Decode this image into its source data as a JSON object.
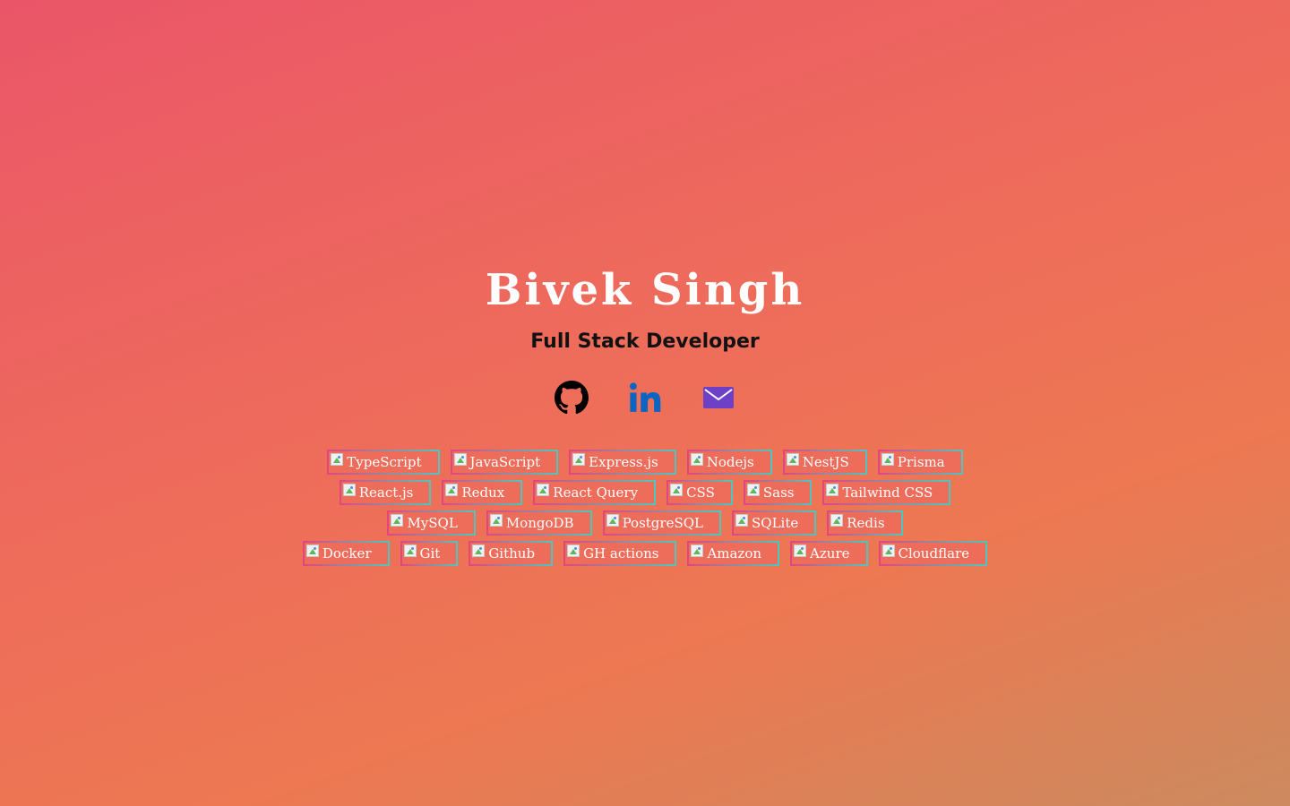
{
  "profile": {
    "name": "Bivek Singh",
    "role": "Full Stack Developer"
  },
  "socials": [
    {
      "icon": "github-icon",
      "color": "#000000"
    },
    {
      "icon": "linkedin-icon",
      "color": "#0a66c2"
    },
    {
      "icon": "mail-icon",
      "color": "#6e3fc7"
    }
  ],
  "skills": {
    "row1": [
      "TypeScript",
      "JavaScript",
      "Express.js",
      "Nodejs",
      "NestJS",
      "Prisma"
    ],
    "row2": [
      "React.js",
      "Redux",
      "React Query",
      "CSS",
      "Sass",
      "Tailwind CSS"
    ],
    "row3": [
      "MySQL",
      "MongoDB",
      "PostgreSQL",
      "SQLite",
      "Redis"
    ],
    "row4": [
      "Docker",
      "Git",
      "Github",
      "GH actions",
      "Amazon",
      "Azure",
      "Cloudflare"
    ]
  },
  "colors": {
    "background_start": "#ea5668",
    "background_end": "#cc8a5e",
    "tag_border_start": "#e2457f",
    "tag_border_end": "#4dc7c0"
  }
}
